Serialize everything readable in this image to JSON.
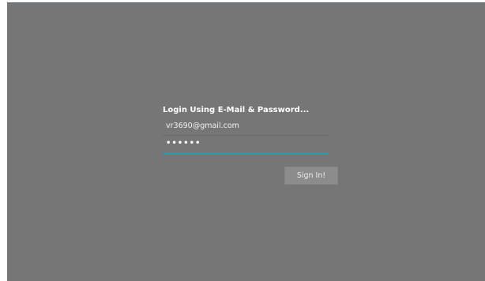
{
  "login": {
    "title": "Login Using E-Mail & Password...",
    "email_value": "vr3690@gmail.com",
    "password_value": "••••••",
    "signin_label": "Sign In!"
  },
  "colors": {
    "screen_background": "#767676",
    "focus_underline": "#2a9aa6",
    "button_background": "#8c8c8c"
  }
}
